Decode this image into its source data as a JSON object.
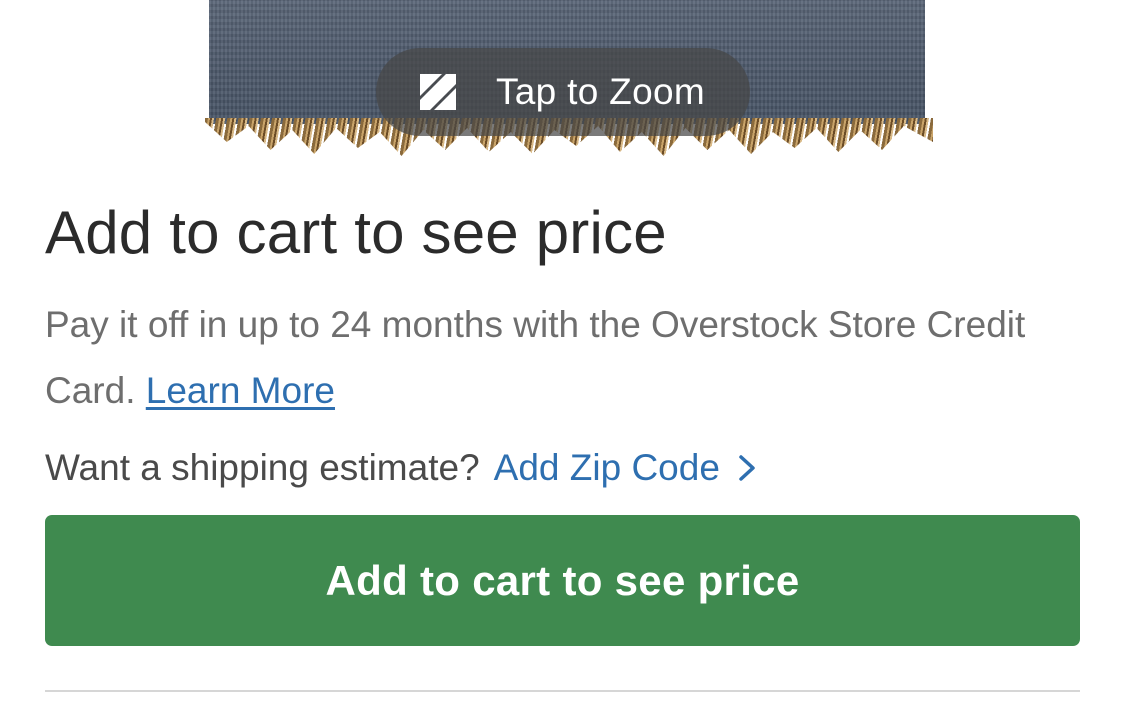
{
  "product_image": {
    "zoom_label": "Tap to Zoom",
    "zoom_icon": "expand-icon"
  },
  "pricing": {
    "headline": "Add to cart to see price",
    "financing_text": "Pay it off in up to 24 months with the Overstock Store Credit Card.",
    "learn_more_label": "Learn More"
  },
  "shipping": {
    "prompt": "Want a shipping estimate?",
    "zip_link_label": "Add Zip Code",
    "chevron_icon": "chevron-right-icon"
  },
  "cart_button": {
    "label": "Add to cart to see price"
  },
  "colors": {
    "button_green": "#3f8a4f",
    "link_blue": "#2e6fb0",
    "headline_text": "#2b2b2b",
    "body_text": "#6e6e6e"
  }
}
